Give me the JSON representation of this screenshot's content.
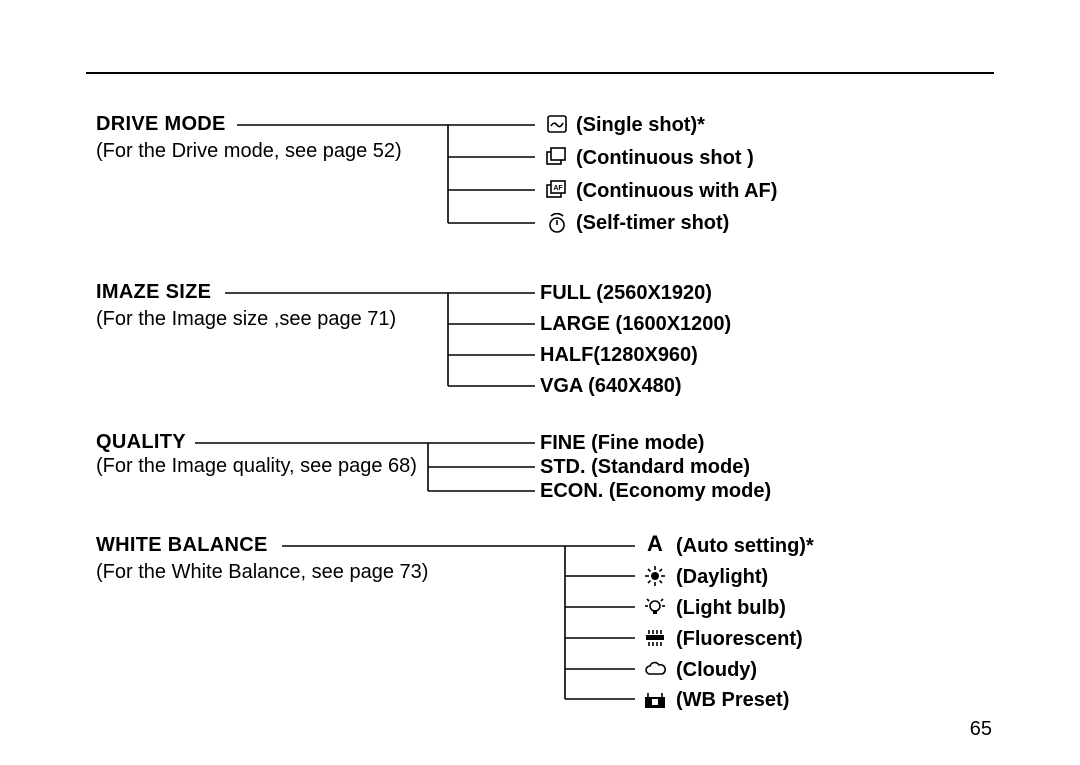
{
  "page_number": "65",
  "sections": {
    "drive": {
      "title": "DRIVE MODE",
      "sub": "(For the Drive mode, see page 52)",
      "options": [
        "(Single shot)*",
        "(Continuous shot )",
        "(Continuous with AF)",
        "(Self-timer shot)"
      ]
    },
    "size": {
      "title": "IMAZE SIZE",
      "sub": "(For the Image size ,see page 71)",
      "options": [
        "FULL (2560X1920)",
        "LARGE (1600X1200)",
        "HALF(1280X960)",
        "VGA (640X480)"
      ]
    },
    "quality": {
      "title": "QUALITY",
      "sub": "(For the Image quality, see page 68)",
      "options": [
        "FINE (Fine mode)",
        "STD. (Standard mode)",
        "ECON. (Economy mode)"
      ]
    },
    "wb": {
      "title": "WHITE BALANCE",
      "sub": "(For the White Balance, see page 73)",
      "options": [
        "(Auto setting)*",
        "(Daylight)",
        "(Light bulb)",
        "(Fluorescent)",
        "(Cloudy)",
        "(WB Preset)"
      ]
    }
  }
}
